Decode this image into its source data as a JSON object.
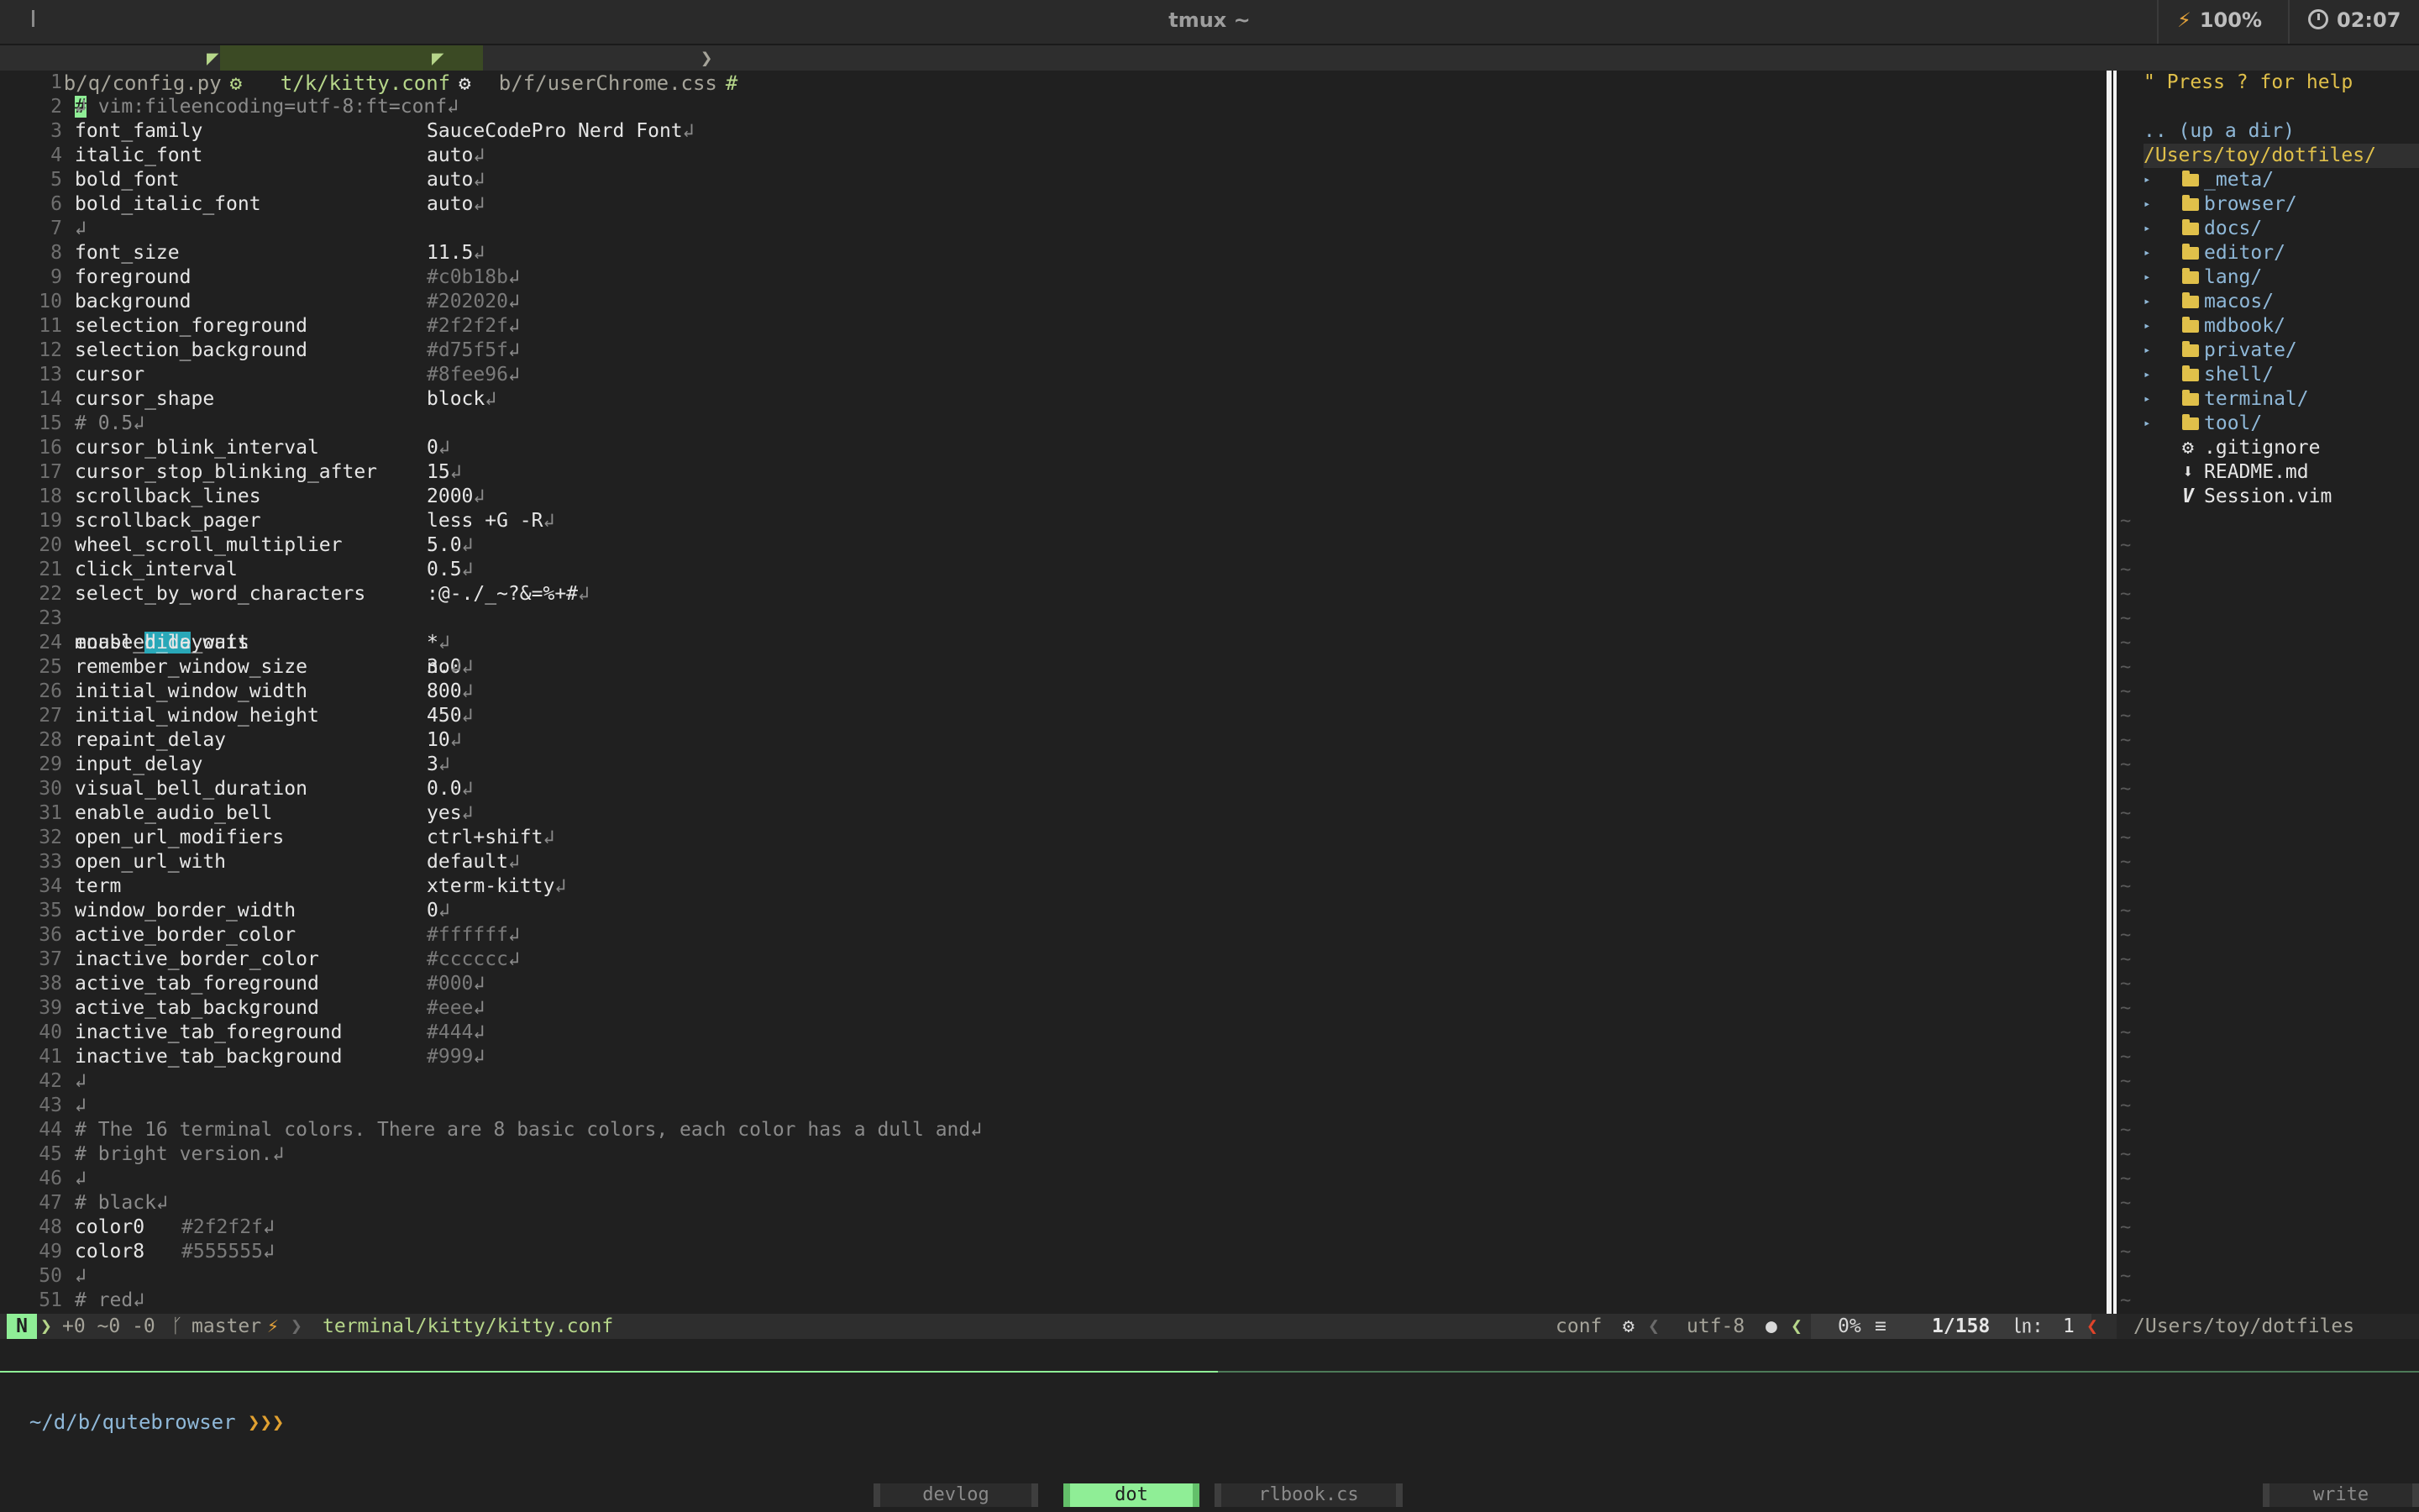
{
  "titlebar": {
    "title": "tmux ~",
    "battery": "100%",
    "battery_icon": "lightning-icon",
    "clock": "02:07",
    "clock_icon": "clock-icon"
  },
  "tabline": {
    "tabs": [
      {
        "label": "b/q/config.py",
        "icon": "⚙"
      },
      {
        "label": "t/k/kitty.conf",
        "icon": "⚙"
      },
      {
        "label": "b/f/userChrome.css",
        "icon": "#"
      }
    ]
  },
  "editor": {
    "line_numbers": [
      "1",
      "2",
      "3",
      "4",
      "5",
      "6",
      "7",
      "8",
      "9",
      "10",
      "11",
      "12",
      "13",
      "14",
      "15",
      "16",
      "17",
      "18",
      "19",
      "20",
      "21",
      "22",
      "23",
      "24",
      "25",
      "26",
      "27",
      "28",
      "29",
      "30",
      "31",
      "32",
      "33",
      "34",
      "35",
      "36",
      "37",
      "38",
      "39",
      "40",
      "41",
      "42",
      "43",
      "44",
      "45",
      "46",
      "47",
      "48",
      "49",
      "50",
      "51"
    ],
    "modeline": " vim:fileencoding=utf-8:ft=conf",
    "modeline_first_char": "#",
    "eol": "↲",
    "settings_a": [
      {
        "key": "font_family",
        "value": "SauceCodePro Nerd Font"
      },
      {
        "key": "italic_font",
        "value": "auto"
      },
      {
        "key": "bold_font",
        "value": "auto"
      },
      {
        "key": "bold_italic_font",
        "value": "auto"
      }
    ],
    "settings_b": [
      {
        "key": "font_size",
        "value": "11.5"
      },
      {
        "key": "foreground",
        "value": "#c0b18b"
      },
      {
        "key": "background",
        "value": "#202020"
      },
      {
        "key": "selection_foreground",
        "value": "#2f2f2f"
      },
      {
        "key": "selection_background",
        "value": "#d75f5f"
      },
      {
        "key": "cursor",
        "value": "#8fee96"
      },
      {
        "key": "cursor_shape",
        "value": "block"
      }
    ],
    "comment_15": "# 0.5",
    "settings_c": [
      {
        "key": "cursor_blink_interval",
        "value": "0"
      },
      {
        "key": "cursor_stop_blinking_after",
        "value": "15"
      },
      {
        "key": "scrollback_lines",
        "value": "2000"
      },
      {
        "key": "scrollback_pager",
        "value": "less +G -R"
      },
      {
        "key": "wheel_scroll_multiplier",
        "value": "5.0"
      },
      {
        "key": "click_interval",
        "value": "0.5"
      },
      {
        "key": "select_by_word_characters",
        "value": ":@-./_~?&=%+#"
      }
    ],
    "line23": {
      "pre": "mouse_",
      "match": "hide",
      "post": "_wait",
      "value": "3.0"
    },
    "settings_d": [
      {
        "key": "enabled_layouts",
        "value": "*"
      },
      {
        "key": "remember_window_size",
        "value": "no"
      },
      {
        "key": "initial_window_width",
        "value": "800"
      },
      {
        "key": "initial_window_height",
        "value": "450"
      },
      {
        "key": "repaint_delay",
        "value": "10"
      },
      {
        "key": "input_delay",
        "value": "3"
      },
      {
        "key": "visual_bell_duration",
        "value": "0.0"
      },
      {
        "key": "enable_audio_bell",
        "value": "yes"
      },
      {
        "key": "open_url_modifiers",
        "value": "ctrl+shift"
      },
      {
        "key": "open_url_with",
        "value": "default"
      },
      {
        "key": "term",
        "value": "xterm-kitty"
      },
      {
        "key": "window_border_width",
        "value": "0"
      },
      {
        "key": "active_border_color",
        "value": "#ffffff"
      },
      {
        "key": "inactive_border_color",
        "value": "#cccccc"
      },
      {
        "key": "active_tab_foreground",
        "value": "#000"
      },
      {
        "key": "active_tab_background",
        "value": "#eee"
      },
      {
        "key": "inactive_tab_foreground",
        "value": "#444"
      },
      {
        "key": "inactive_tab_background",
        "value": "#999"
      }
    ],
    "comment_44": "# The 16 terminal colors. There are 8 basic colors, each color has a dull and",
    "comment_45": "# bright version.",
    "comment_47": "# black",
    "colors": [
      {
        "key": "color0",
        "value": "#2f2f2f"
      },
      {
        "key": "color8",
        "value": "#555555"
      }
    ],
    "comment_51": "# red"
  },
  "nerdtree": {
    "help": "\" Press ? for help",
    "updir": ".. (up a dir)",
    "root": "/Users/toy/dotfiles/",
    "folders": [
      "_meta/",
      "browser/",
      "docs/",
      "editor/",
      "lang/",
      "macos/",
      "mdbook/",
      "private/",
      "shell/",
      "terminal/",
      "tool/"
    ],
    "folder_arrow": "▸",
    "files": [
      {
        "name": ".gitignore",
        "icon": "⚙"
      },
      {
        "name": "README.md",
        "icon": "⬇"
      },
      {
        "name": "Session.vim",
        "icon": "V"
      }
    ],
    "tilde": "~"
  },
  "statusline": {
    "mode": "N",
    "git_stats": "+0 ~0 -0",
    "branch": "master",
    "branch_icon": "ᚴ",
    "dirty_icon": "⚡",
    "filepath": "terminal/kitty/kitty.conf",
    "filetype": "conf",
    "encoding": "utf-8",
    "percent": "0%",
    "position": "1/158",
    "ln_label": "㏑:",
    "column": "1",
    "nerdtree_path": "/Users/toy/dotfiles"
  },
  "shell": {
    "cwd": "~/d/b/qutebrowser",
    "prompt": "❯❯❯"
  },
  "tmux": {
    "windows": [
      "devlog",
      "dot",
      "rlbook.cs",
      "write"
    ],
    "active": "dot"
  },
  "colors": {
    "accent_green": "#8fee96",
    "background": "#202020",
    "foreground": "#c0b18b",
    "search_highlight": "#29a8b8",
    "nerdtree_root": "#e0c04a"
  }
}
